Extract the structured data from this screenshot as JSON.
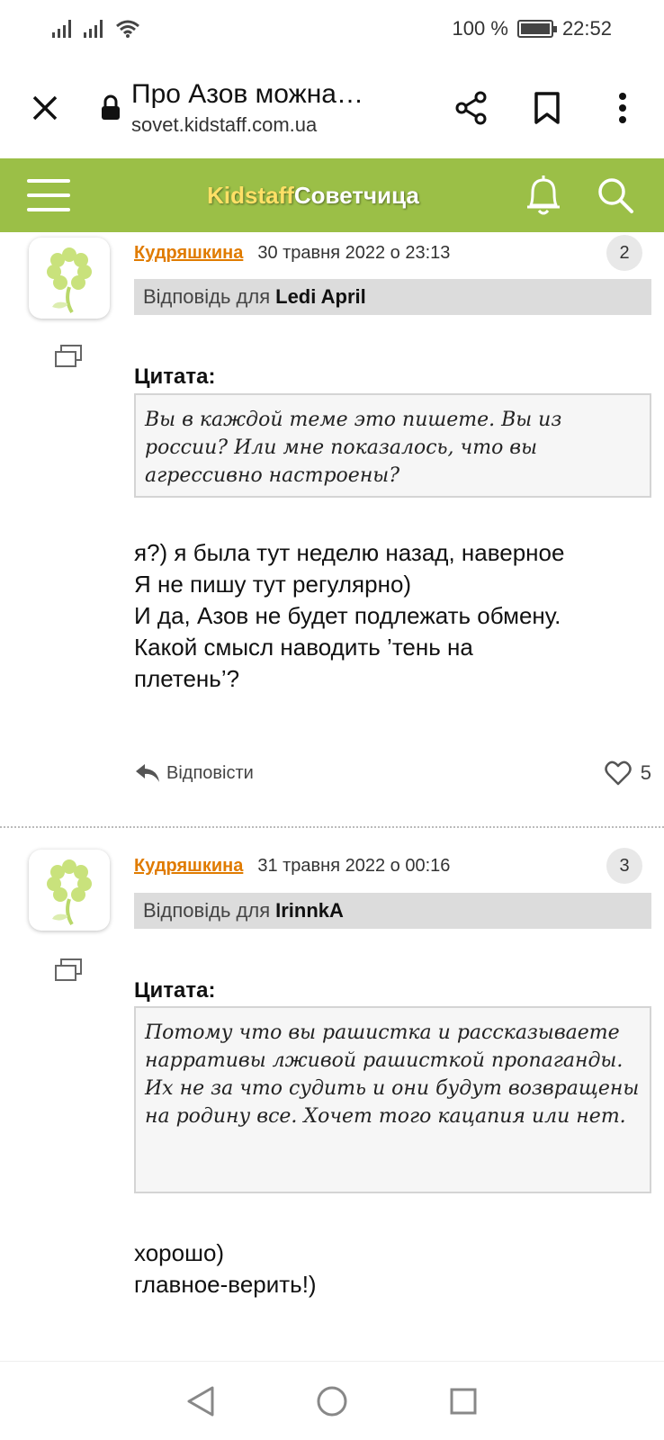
{
  "status": {
    "battery": "100 %",
    "time": "22:52"
  },
  "browser": {
    "title": "Про Азов можна…",
    "url": "sovet.kidstaff.com.ua"
  },
  "header": {
    "logo_part1": "Kidstaff",
    "logo_part2": "Советчица"
  },
  "posts": [
    {
      "author": "Кудряшкина",
      "date": "30 травня 2022 о 23:13",
      "number": "2",
      "reply_prefix": "Відповідь для",
      "reply_to": "Ledi April",
      "quote_label": "Цитата:",
      "quote": "Вы в каждой теме это пишете. Вы из россии? Или мне показалось, что вы агрессивно настроены?",
      "lines": [
        "я?) я была тут неделю назад, наверное",
        "Я не пишу тут регулярно)",
        "И да, Азов не будет подлежать обмену.",
        "Какой смысл наводить ’тень на",
        "плетень’?"
      ],
      "reply_action": "Відповісти",
      "likes": "5"
    },
    {
      "author": "Кудряшкина",
      "date": "31 травня 2022 о 00:16",
      "number": "3",
      "reply_prefix": "Відповідь для",
      "reply_to": "IrinnkA",
      "quote_label": "Цитата:",
      "quote": "Потому что вы рашистка и рассказываете нарративы лживой рашисткой пропаганды. Их не за что судить и они будут возвращены на родину все. Хочет того кацапия или нет.",
      "lines": [
        "хорошо)",
        "главное-верить!)"
      ]
    }
  ],
  "icons": {
    "close": "close-icon",
    "lock": "lock-icon",
    "share": "share-icon",
    "bookmark": "bookmark-icon",
    "more": "more-vert-icon",
    "menu": "hamburger-icon",
    "bell": "bell-icon",
    "search": "search-icon",
    "reply": "reply-arrow-icon",
    "heart": "heart-icon",
    "quote": "quote-icon",
    "avatar": "flower-avatar-icon"
  },
  "colors": {
    "header_bg": "#9bbf47",
    "author": "#e07b00",
    "logo_accent": "#ffe066"
  }
}
